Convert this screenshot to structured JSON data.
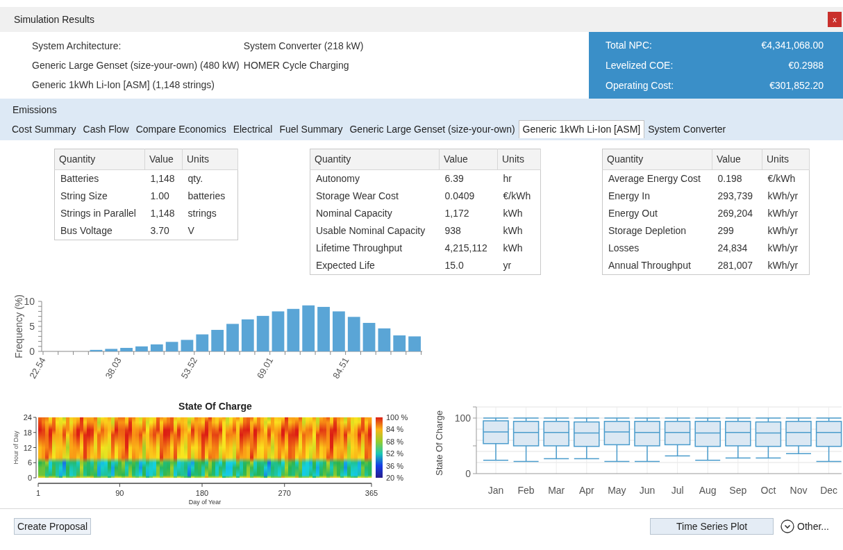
{
  "window": {
    "title": "Simulation Results",
    "close": "x"
  },
  "architecture": {
    "label": "System Architecture:",
    "items": [
      "Generic Large Genset (size-your-own) (480 kW)",
      "Generic 1kWh Li-Ion [ASM] (1,148 strings)",
      "System Converter (218 kW)",
      "HOMER Cycle Charging"
    ]
  },
  "summary": [
    {
      "label": "Total NPC:",
      "value": "€4,341,068.00"
    },
    {
      "label": "Levelized COE:",
      "value": "€0.2988"
    },
    {
      "label": "Operating Cost:",
      "value": "€301,852.20"
    }
  ],
  "tabs_top": [
    {
      "label": "Emissions",
      "selected": false
    }
  ],
  "tabs": [
    {
      "label": "Cost Summary",
      "selected": false
    },
    {
      "label": "Cash Flow",
      "selected": false
    },
    {
      "label": "Compare Economics",
      "selected": false
    },
    {
      "label": "Electrical",
      "selected": false
    },
    {
      "label": "Fuel Summary",
      "selected": false
    },
    {
      "label": "Generic Large Genset (size-your-own)",
      "selected": false
    },
    {
      "label": "Generic 1kWh Li-Ion [ASM]",
      "selected": true
    },
    {
      "label": "System Converter",
      "selected": false
    }
  ],
  "tables": [
    {
      "columns": [
        "Quantity",
        "Value",
        "Units"
      ],
      "rows": [
        [
          "Batteries",
          "1,148",
          "qty."
        ],
        [
          "String Size",
          "1.00",
          "batteries"
        ],
        [
          "Strings in Parallel",
          "1,148",
          "strings"
        ],
        [
          "Bus Voltage",
          "3.70",
          "V"
        ]
      ]
    },
    {
      "columns": [
        "Quantity",
        "Value",
        "Units"
      ],
      "rows": [
        [
          "Autonomy",
          "6.39",
          "hr"
        ],
        [
          "Storage Wear Cost",
          "0.0409",
          "€/kWh"
        ],
        [
          "Nominal Capacity",
          "1,172",
          "kWh"
        ],
        [
          "Usable Nominal Capacity",
          "938",
          "kWh"
        ],
        [
          "Lifetime Throughput",
          "4,215,112",
          "kWh"
        ],
        [
          "Expected Life",
          "15.0",
          "yr"
        ]
      ]
    },
    {
      "columns": [
        "Quantity",
        "Value",
        "Units"
      ],
      "rows": [
        [
          "Average Energy Cost",
          "0.198",
          "€/kWh"
        ],
        [
          "Energy In",
          "293,739",
          "kWh/yr"
        ],
        [
          "Energy Out",
          "269,204",
          "kWh/yr"
        ],
        [
          "Storage Depletion",
          "299",
          "kWh/yr"
        ],
        [
          "Losses",
          "24,834",
          "kWh/yr"
        ],
        [
          "Annual Throughput",
          "281,007",
          "kWh/yr"
        ]
      ]
    }
  ],
  "histogram": {
    "chart_data": {
      "type": "bar",
      "ylabel": "Frequency (%)",
      "x": [
        33.39,
        36.48,
        39.58,
        42.68,
        45.78,
        48.87,
        51.97,
        55.07,
        58.17,
        61.27,
        64.36,
        67.46,
        70.56,
        73.66,
        76.76,
        79.86,
        82.96,
        86.06,
        89.15,
        92.25,
        95.35,
        98.45
      ],
      "series": [
        {
          "color": "#5aa5d6",
          "values": [
            0.3,
            0.5,
            0.7,
            1.0,
            1.4,
            1.9,
            2.3,
            3.4,
            4.3,
            5.5,
            6.4,
            7.1,
            8.0,
            8.5,
            9.2,
            8.9,
            8.0,
            6.9,
            5.7,
            4.6,
            3.2,
            3.0
          ]
        }
      ],
      "xticks": [
        22.54,
        38.03,
        53.52,
        69.01,
        84.51
      ],
      "xlim": [
        22.54,
        100
      ],
      "yticks": [
        0,
        5,
        10
      ],
      "ylim": [
        0,
        10
      ]
    }
  },
  "heatmap": {
    "title": "State Of Charge",
    "ylabel": "Hour of Day",
    "xlabel": "Day of Year",
    "yticks": [
      "24",
      "18",
      "12",
      "6",
      "0"
    ],
    "xticks": [
      "1",
      "90",
      "180",
      "270",
      "365"
    ],
    "scale": [
      "100 %",
      "84 %",
      "68 %",
      "52 %",
      "36 %",
      "20 %"
    ]
  },
  "boxplot": {
    "ylabel": "State Of Charge",
    "yticks": [
      "100",
      "0"
    ],
    "months": [
      "Jan",
      "Feb",
      "Mar",
      "Apr",
      "May",
      "Jun",
      "Jul",
      "Aug",
      "Sep",
      "Oct",
      "Nov",
      "Dec"
    ]
  },
  "buttons": {
    "proposal": "Create Proposal",
    "time_series": "Time Series Plot",
    "other": "Other..."
  }
}
